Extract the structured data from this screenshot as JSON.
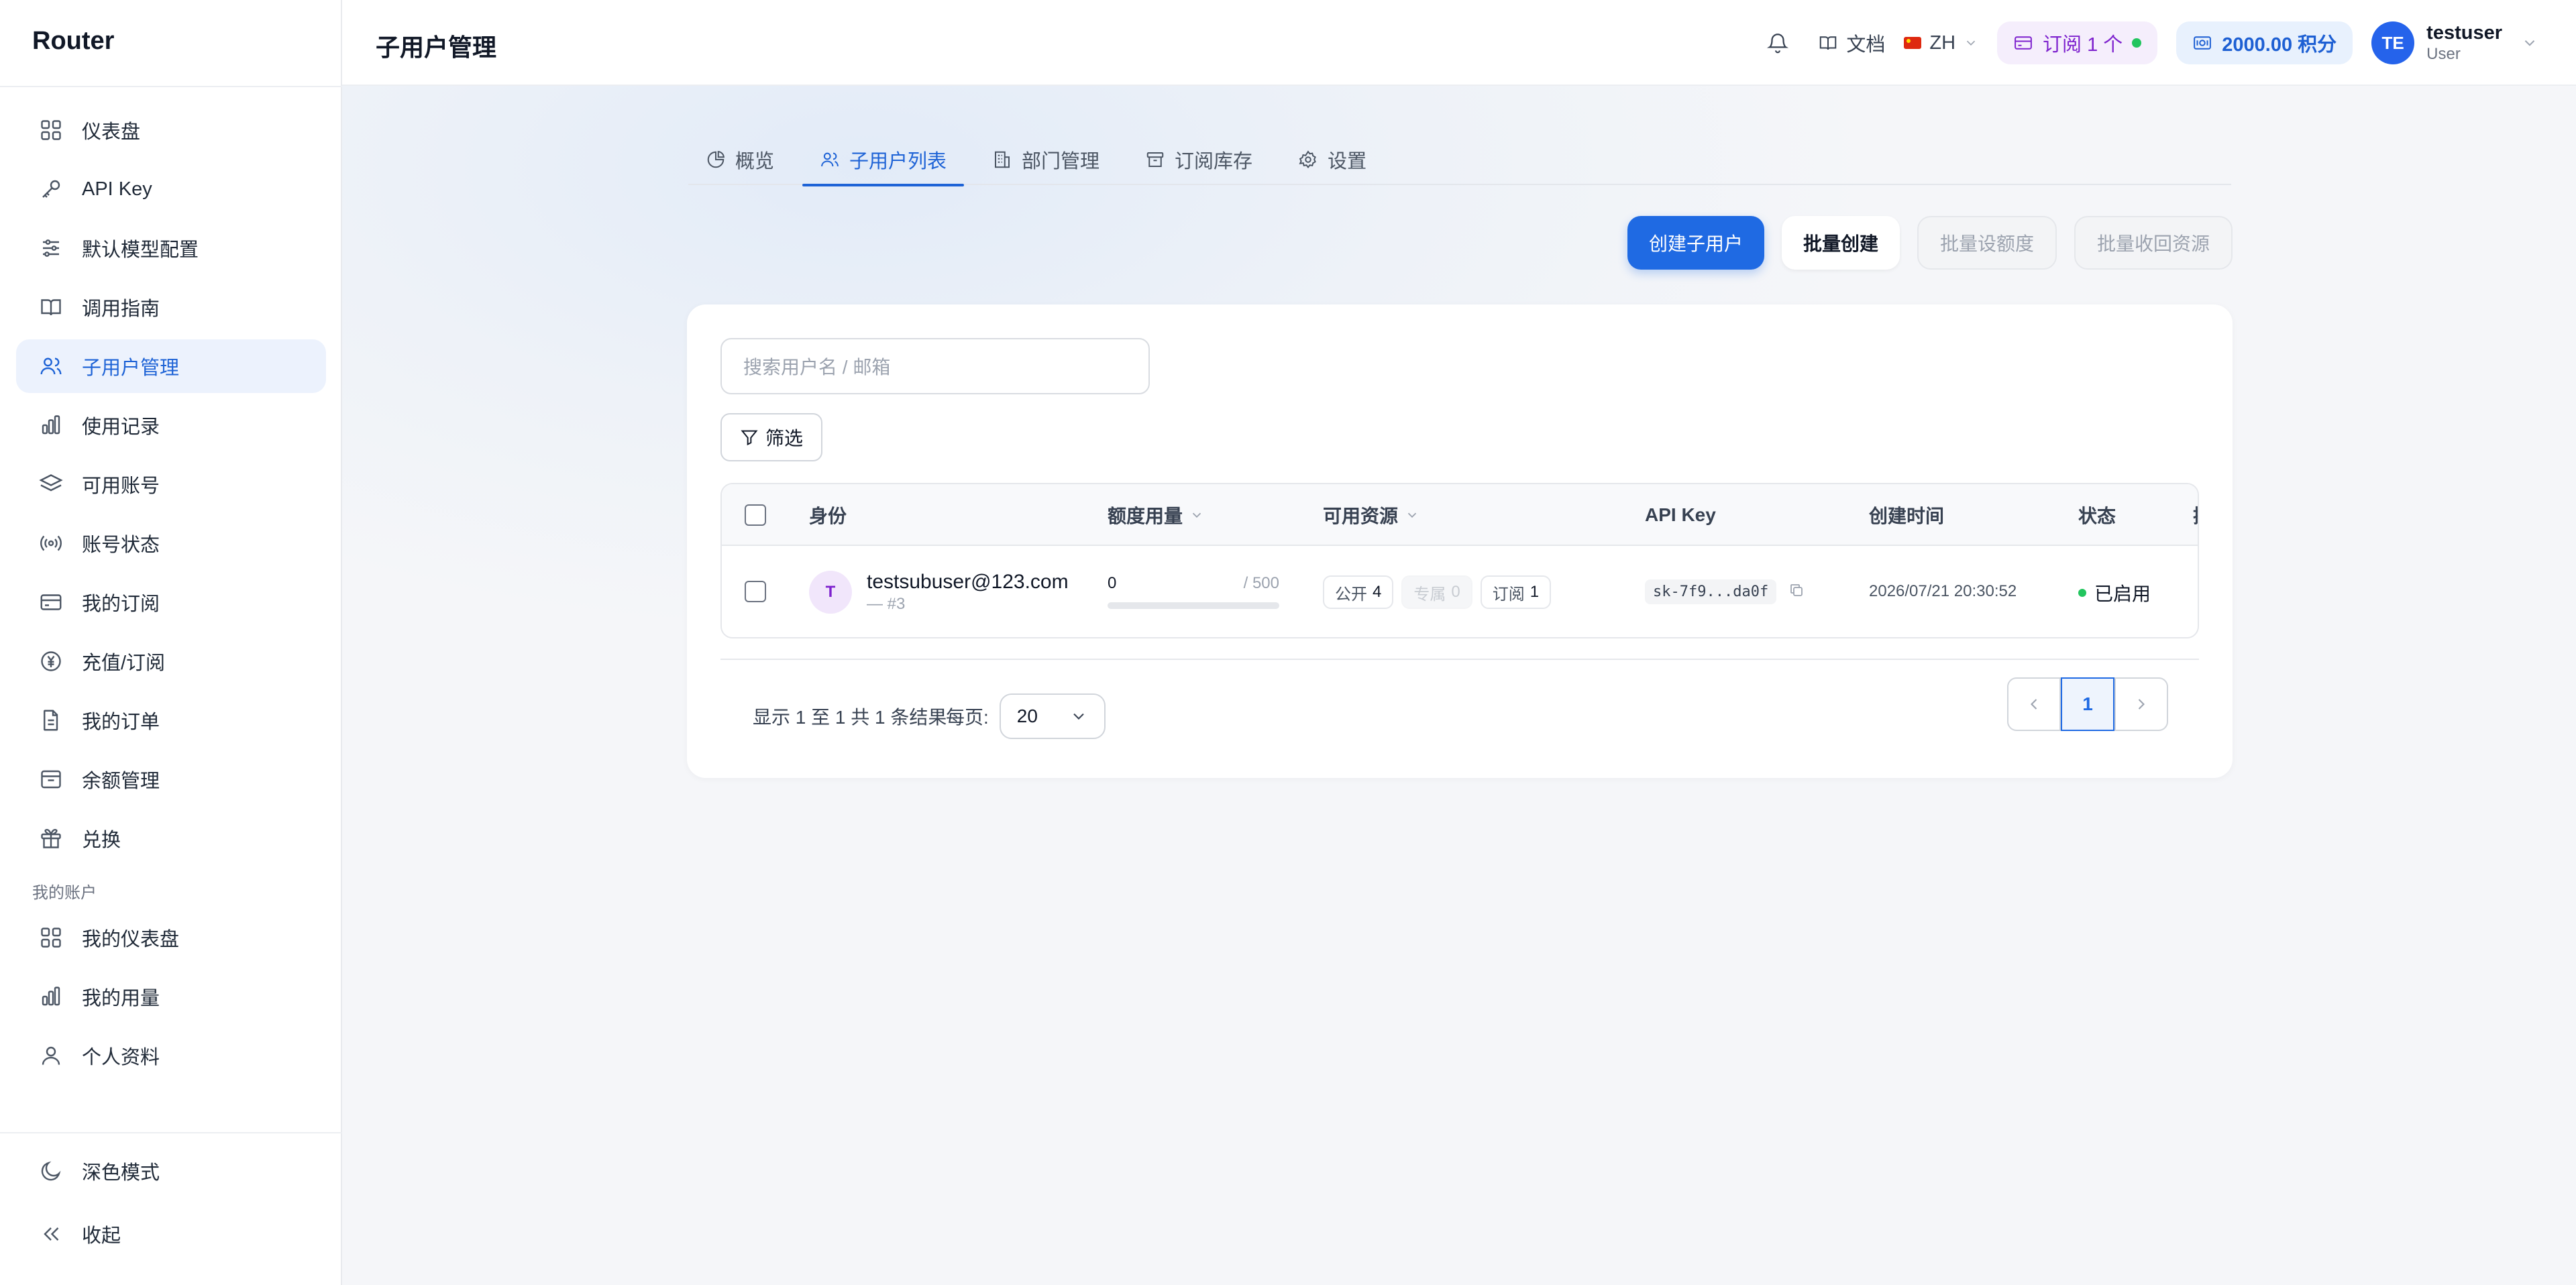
{
  "app": {
    "brand": "Router",
    "page_title": "子用户管理"
  },
  "sidebar": {
    "items": [
      {
        "label": "仪表盘",
        "icon": "grid-icon"
      },
      {
        "label": "API Key",
        "icon": "key-icon"
      },
      {
        "label": "默认模型配置",
        "icon": "sliders-icon"
      },
      {
        "label": "调用指南",
        "icon": "book-icon"
      },
      {
        "label": "子用户管理",
        "icon": "users-icon",
        "active": true
      },
      {
        "label": "使用记录",
        "icon": "bar-chart-icon"
      },
      {
        "label": "可用账号",
        "icon": "layers-icon"
      },
      {
        "label": "账号状态",
        "icon": "broadcast-icon"
      },
      {
        "label": "我的订阅",
        "icon": "credit-card-icon"
      },
      {
        "label": "充值/订阅",
        "icon": "yen-icon"
      },
      {
        "label": "我的订单",
        "icon": "document-icon"
      },
      {
        "label": "余额管理",
        "icon": "wallet-icon"
      },
      {
        "label": "兑换",
        "icon": "gift-icon"
      }
    ],
    "section_title": "我的账户",
    "account_items": [
      {
        "label": "我的仪表盘",
        "icon": "grid-icon"
      },
      {
        "label": "我的用量",
        "icon": "bar-chart-icon"
      },
      {
        "label": "个人资料",
        "icon": "user-icon"
      }
    ],
    "dark_mode": "深色模式",
    "collapse": "收起"
  },
  "header": {
    "docs": "文档",
    "lang": "ZH",
    "subscription": "订阅 1 个",
    "points": "2000.00 积分",
    "user": {
      "initials": "TE",
      "name": "testuser",
      "role": "User"
    }
  },
  "tabs": [
    {
      "label": "概览",
      "icon": "pie-icon"
    },
    {
      "label": "子用户列表",
      "icon": "users-icon",
      "active": true
    },
    {
      "label": "部门管理",
      "icon": "building-icon"
    },
    {
      "label": "订阅库存",
      "icon": "archive-icon"
    },
    {
      "label": "设置",
      "icon": "gear-icon"
    }
  ],
  "actions": {
    "create": "创建子用户",
    "batch_create": "批量创建",
    "batch_quota": "批量设额度",
    "batch_reclaim": "批量收回资源"
  },
  "search": {
    "placeholder": "搜索用户名 / 邮箱"
  },
  "filter": {
    "label": "筛选"
  },
  "table": {
    "columns": [
      "身份",
      "额度用量",
      "可用资源",
      "API Key",
      "创建时间",
      "状态",
      "操"
    ],
    "rows": [
      {
        "avatar": "T",
        "email": "testsubuser@123.com",
        "sub": "— #3",
        "quota_used": "0",
        "quota_max": "/ 500",
        "quota_fraction": 0,
        "res_public_label": "公开",
        "res_public": "4",
        "res_private_label": "专属",
        "res_private": "0",
        "res_sub_label": "订阅",
        "res_sub": "1",
        "api_key": "sk-7f9...da0f",
        "created": "2026/07/21 20:30:52",
        "status": "已启用"
      }
    ]
  },
  "pagination": {
    "summary": "显示 1 至 1 共 1 条结果",
    "per_page_label": "每页:",
    "per_page": "20",
    "current": "1"
  },
  "colors": {
    "primary": "#1f6ae3",
    "active_bg": "#ecf2fd",
    "success": "#22c55e",
    "subscription": "#7e22ce"
  }
}
